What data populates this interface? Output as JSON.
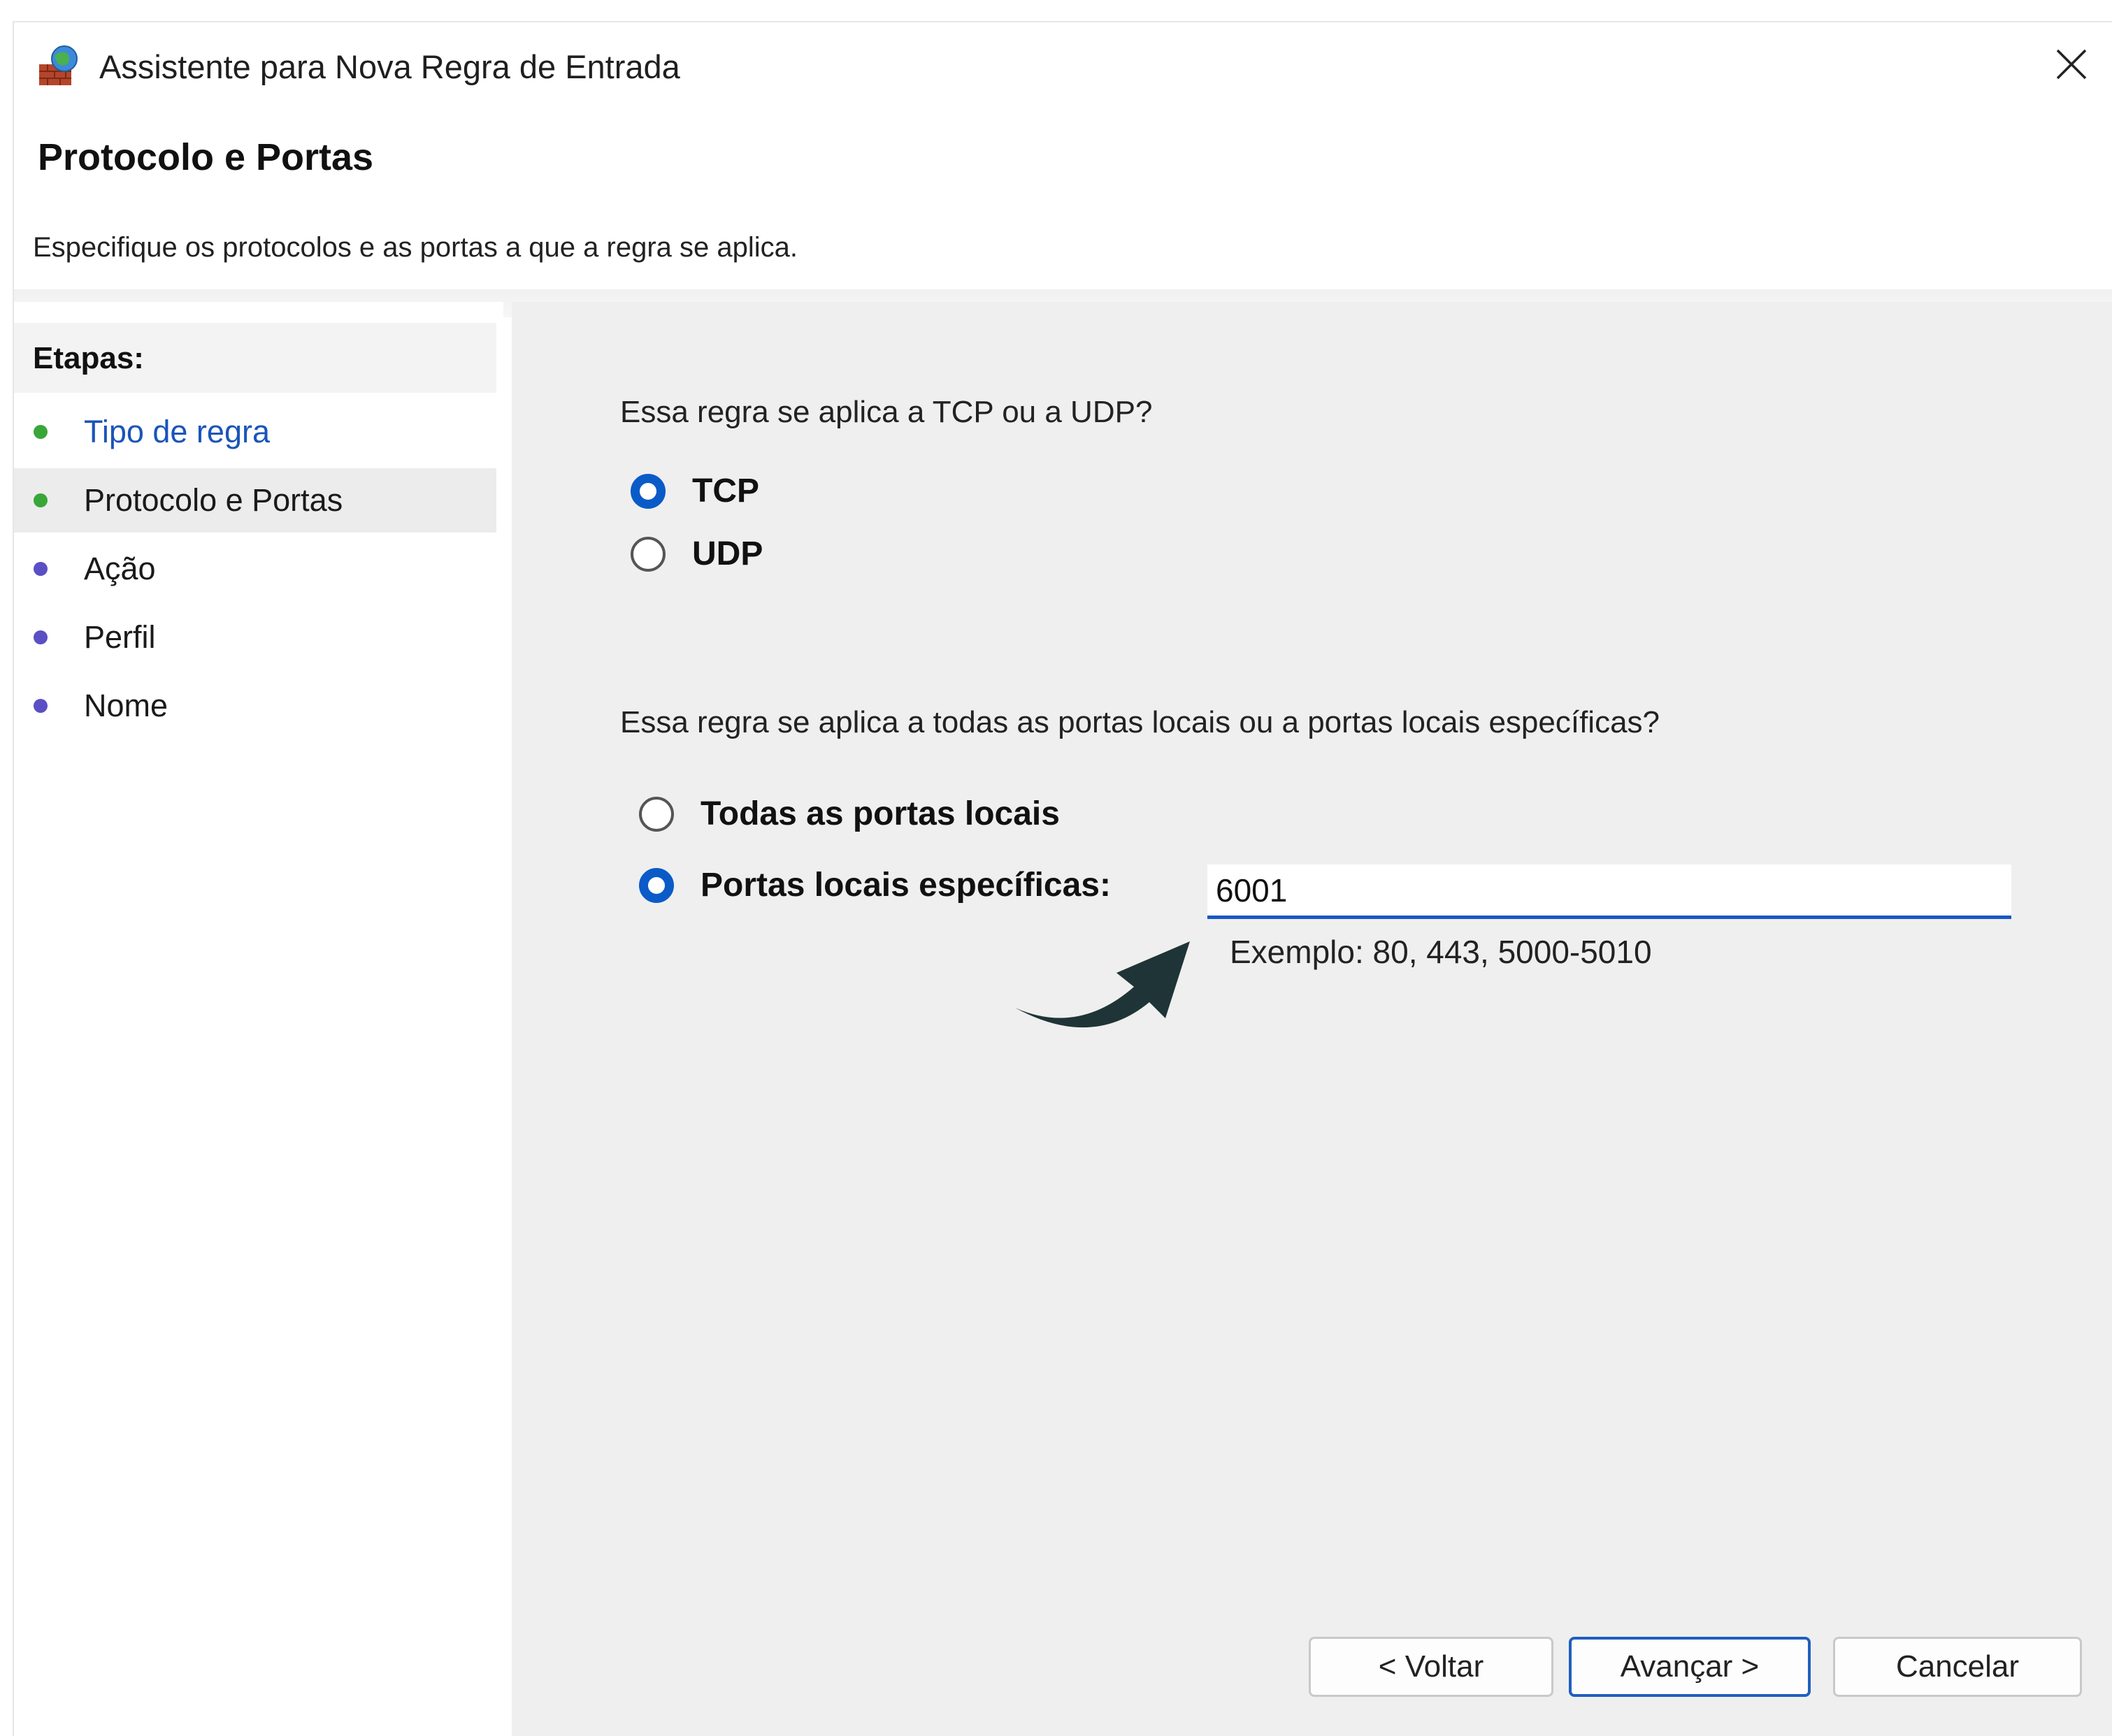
{
  "window": {
    "title": "Assistente para Nova Regra de Entrada",
    "icon": "firewall-icon",
    "close_icon": "close-icon"
  },
  "header": {
    "title": "Protocolo e Portas",
    "description": "Especifique os protocolos e as portas a que a regra se aplica."
  },
  "sidebar": {
    "label": "Etapas:",
    "steps": [
      {
        "label": "Tipo de regra",
        "color": "#1a55b8",
        "dot": "#3aa63a"
      },
      {
        "label": "Protocolo e Portas",
        "color": "#1a1a1a",
        "dot": "#3aa63a",
        "active": true
      },
      {
        "label": "Ação",
        "color": "#1a1a1a",
        "dot": "#5a4fc4"
      },
      {
        "label": "Perfil",
        "color": "#1a1a1a",
        "dot": "#5a4fc4"
      },
      {
        "label": "Nome",
        "color": "#1a1a1a",
        "dot": "#5a4fc4"
      }
    ]
  },
  "protocol": {
    "question": "Essa regra se aplica a TCP ou a UDP?",
    "options": [
      {
        "label": "TCP",
        "checked": true
      },
      {
        "label": "UDP",
        "checked": false
      }
    ]
  },
  "ports": {
    "question": "Essa regra se aplica a todas as portas locais ou a portas locais específicas?",
    "options": [
      {
        "label": "Todas as portas locais",
        "checked": false
      },
      {
        "label": "Portas locais específicas:",
        "checked": true
      }
    ],
    "value": "6001",
    "example": "Exemplo: 80, 443, 5000-5010"
  },
  "buttons": {
    "back": "< Voltar",
    "next": "Avançar >",
    "cancel": "Cancelar"
  },
  "colors": {
    "accent": "#0a5bc7",
    "arrow": "#1f3436"
  }
}
